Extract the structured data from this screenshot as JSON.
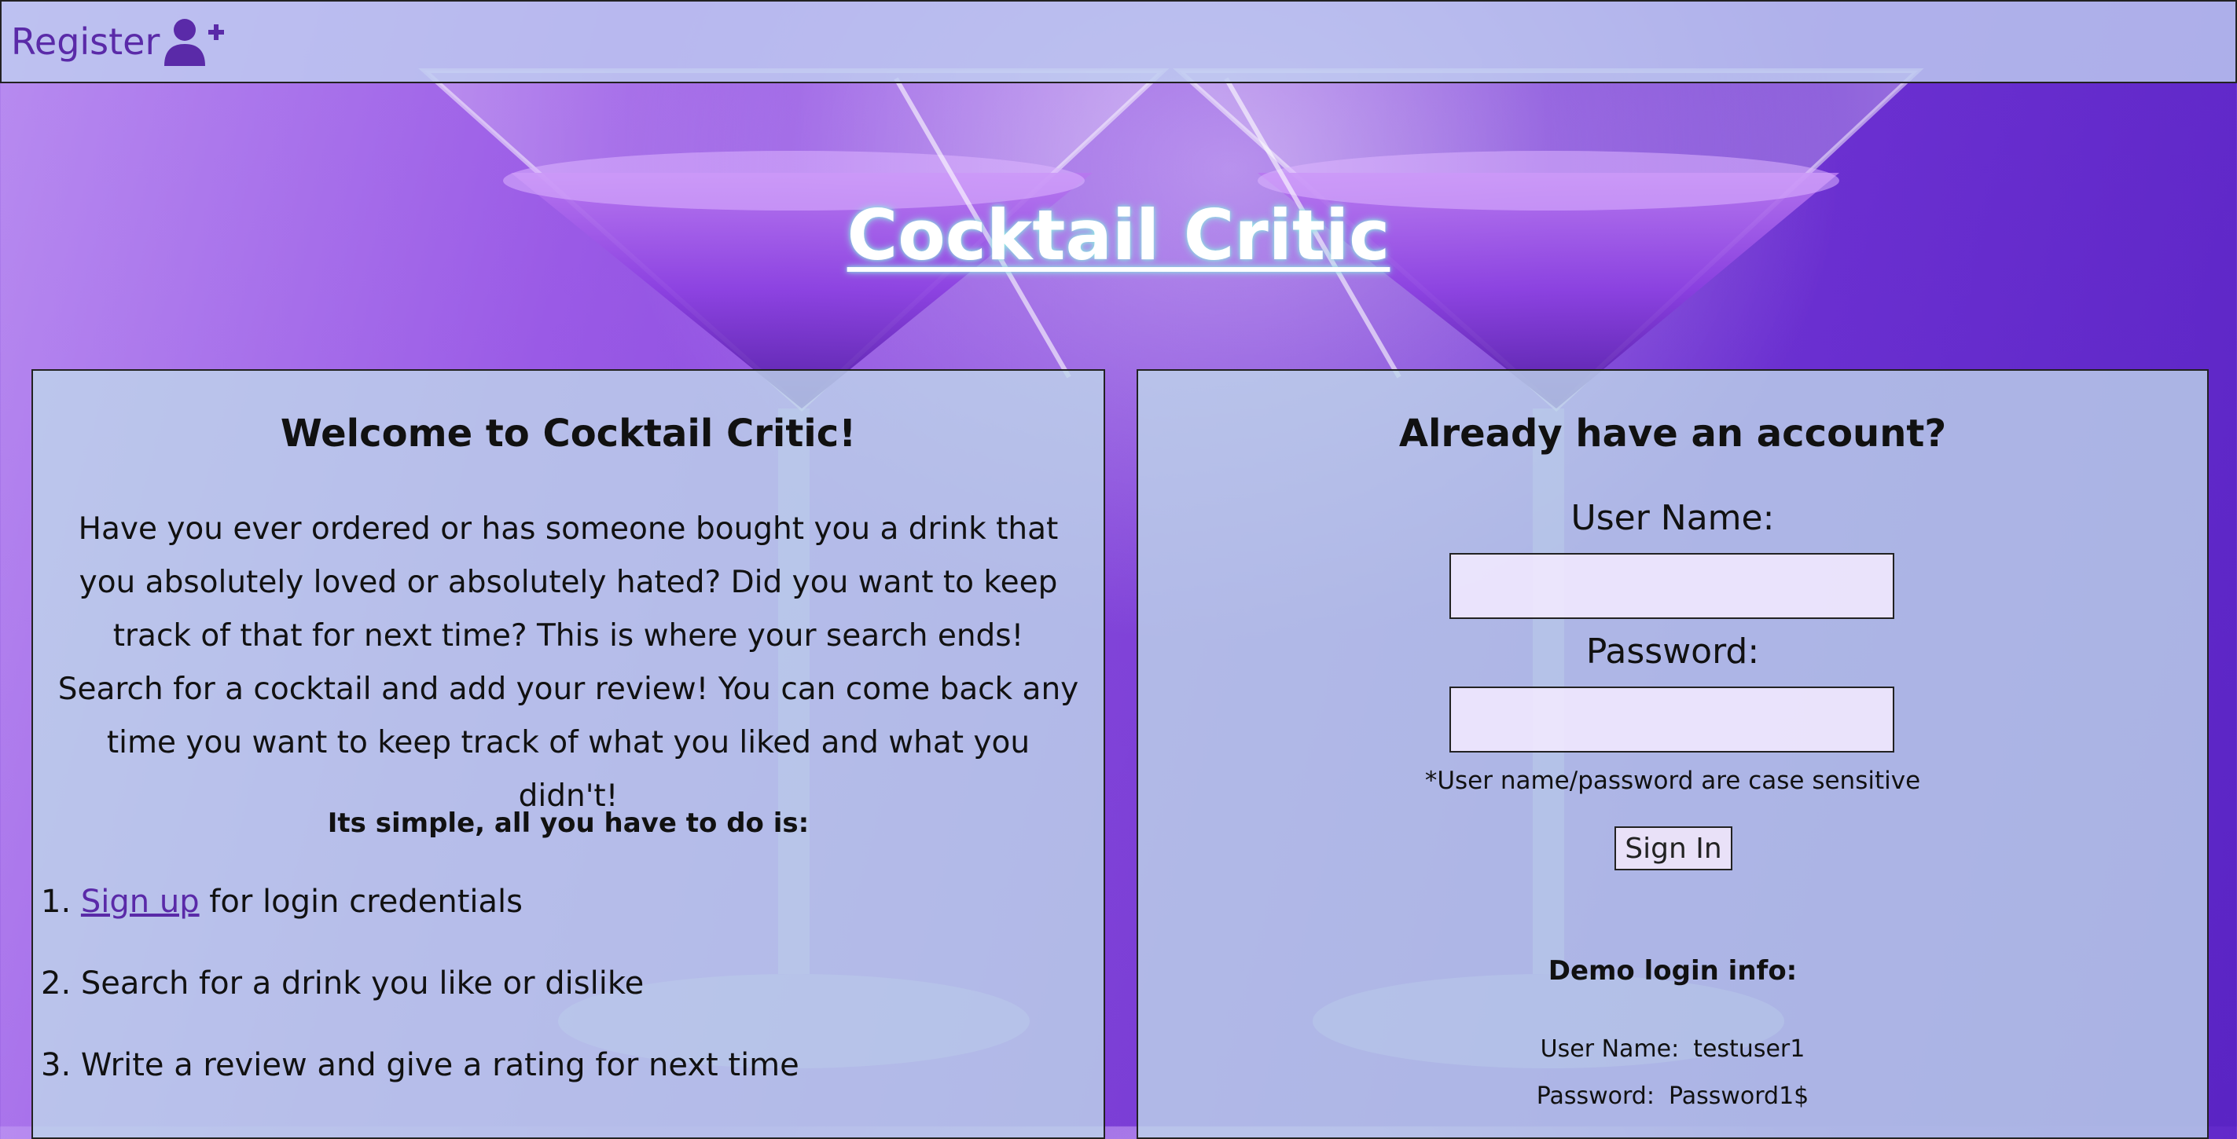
{
  "nav": {
    "register_label": "Register"
  },
  "header": {
    "title": "Cocktail Critic"
  },
  "welcome": {
    "heading": "Welcome to Cocktail Critic!",
    "intro": "Have you ever ordered or has someone bought you a drink that you absolutely loved or absolutely hated? Did you want to keep track of that for next time? This is where your search ends! Search for a cocktail and add your review! You can come back any time you want to keep track of what you liked and what you didn't!",
    "simple_heading": "Its simple, all you have to do is:",
    "steps": [
      {
        "number": "1.",
        "link": "Sign up",
        "text": " for login credentials"
      },
      {
        "number": "2.",
        "text": " Search for a drink you like or dislike"
      },
      {
        "number": "3.",
        "text": " Write a review and give a rating for next time"
      }
    ]
  },
  "login": {
    "heading": "Already have an account?",
    "username_label": "User Name:",
    "username_value": "",
    "password_label": "Password:",
    "password_value": "",
    "case_note": "*User name/password are case sensitive",
    "signin_label": "Sign In",
    "demo_heading": "Demo login info:",
    "demo_username_label": "User Name:",
    "demo_username_value": "testuser1",
    "demo_password_label": "Password:",
    "demo_password_value": "Password1$"
  },
  "colors": {
    "accent": "#5a2aa8",
    "background": "#7c3fd6",
    "panel": "#bed7eb"
  },
  "icons": {
    "register": "user-plus-icon"
  }
}
